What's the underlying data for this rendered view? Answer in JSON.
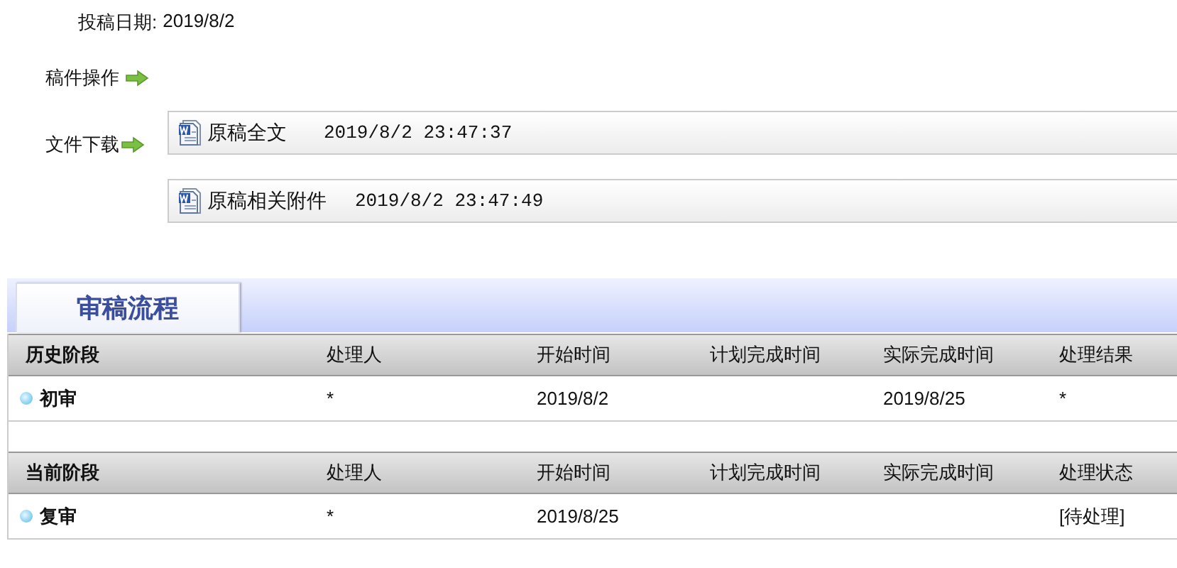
{
  "submission_date": {
    "label": "投稿日期:",
    "value": "2019/8/2"
  },
  "operations": {
    "label": "稿件操作"
  },
  "downloads": {
    "label": "文件下载",
    "files": [
      {
        "name": "原稿全文",
        "time": "2019/8/2 23:47:37"
      },
      {
        "name": "原稿相关附件",
        "time": "2019/8/2 23:47:49"
      }
    ]
  },
  "workflow": {
    "tabs": [
      {
        "label": "审稿流程",
        "selected": true
      }
    ],
    "sections": [
      {
        "columns": [
          "历史阶段",
          "处理人",
          "开始时间",
          "计划完成时间",
          "实际完成时间",
          "处理结果"
        ],
        "rows": [
          [
            "初审",
            "*",
            "2019/8/2",
            "",
            "2019/8/25",
            "*"
          ]
        ]
      },
      {
        "columns": [
          "当前阶段",
          "处理人",
          "开始时间",
          "计划完成时间",
          "实际完成时间",
          "处理状态"
        ],
        "rows": [
          [
            "复审",
            "*",
            "2019/8/25",
            "",
            "",
            "[待处理]"
          ]
        ]
      }
    ]
  }
}
